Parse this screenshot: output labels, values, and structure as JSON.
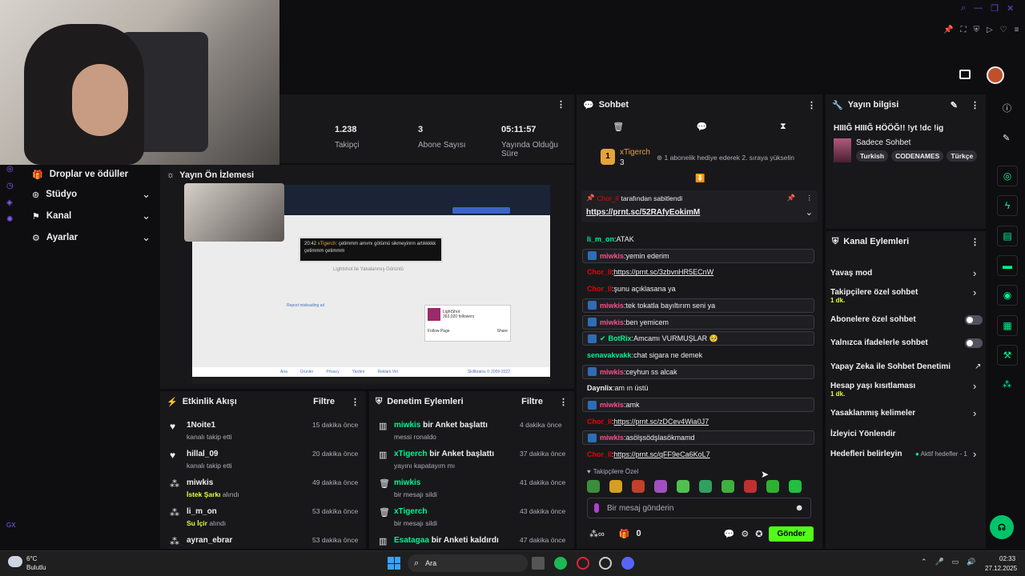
{
  "topbar": {
    "avatar_color": "#c0502a"
  },
  "stats": [
    {
      "value": "1.238",
      "label": "Takipçi"
    },
    {
      "value": "3",
      "label": "Abone Sayısı"
    },
    {
      "value": "05:11:57",
      "label": "Yayında Olduğu Süre"
    }
  ],
  "sidebar": {
    "items": [
      {
        "label": "Droplar ve ödüller",
        "icon": "gift-icon"
      },
      {
        "label": "Stüdyo",
        "icon": "studio-icon"
      },
      {
        "label": "Kanal",
        "icon": "channel-icon"
      },
      {
        "label": "Ayarlar",
        "icon": "gear-icon"
      }
    ],
    "gx": "GX"
  },
  "preview": {
    "title": "Yayın Ön İzlemesi",
    "overlay_time": "20:42",
    "overlay_user": "xTigerch",
    "overlay_msg": "çetimmm amımı götümü sikmeyinnn artıkkkkk çetimmm çetimmm",
    "site_title": "Lightshot ile Yakalanmış Görüntü",
    "ls_brand": "LightShot",
    "ls_followers": "363,020 followers",
    "ls_follow": "Follow Page",
    "ls_share": "Share",
    "footer_links": [
      "Ana",
      "Ürünler",
      "Privacy",
      "Yardım",
      "Reklam Ver"
    ],
    "footer_right": "Skillbrains © 2009-2022",
    "report": "Report misleading ad"
  },
  "activity": {
    "title": "Etkinlik Akışı",
    "filter": "Filtre",
    "items": [
      {
        "name": "1Noite1",
        "sub": "kanalı takip etti",
        "time": "15 dakika önce",
        "icon": "heart-icon"
      },
      {
        "name": "hillal_09",
        "sub": "kanalı takip etti",
        "time": "20 dakika önce",
        "icon": "heart-icon"
      },
      {
        "name": "miwkis",
        "sub_hl": "İstek Şarkı",
        "sub": "alındı",
        "time": "49 dakika önce",
        "icon": "points-icon"
      },
      {
        "name": "li_m_on",
        "sub_hl": "Su İçir",
        "sub": "alındı",
        "time": "53 dakika önce",
        "icon": "points-icon"
      },
      {
        "name": "ayran_ebrar",
        "sub": "",
        "time": "53 dakika önce",
        "icon": "points-icon"
      }
    ]
  },
  "mod_actions": {
    "title": "Denetim Eylemleri",
    "filter": "Filtre",
    "items": [
      {
        "name": "miwkis",
        "action": "bir Anket başlattı",
        "sub": "messi ronaldo",
        "time": "4 dakika önce",
        "icon": "poll-icon"
      },
      {
        "name": "xTigerch",
        "action": "bir Anket başlattı",
        "sub": "yayını kapatayım mı",
        "time": "37 dakika önce",
        "icon": "poll-icon"
      },
      {
        "name": "miwkis",
        "action": "",
        "sub": "bir mesajı sildi",
        "time": "41 dakika önce",
        "icon": "trash-icon"
      },
      {
        "name": "xTigerch",
        "action": "",
        "sub": "bir mesajı sildi",
        "time": "43 dakika önce",
        "icon": "trash-icon"
      },
      {
        "name": "Esatagaa",
        "action": "bir Anketi kaldırdı",
        "sub": "",
        "time": "47 dakika önce",
        "icon": "poll-icon"
      }
    ]
  },
  "chat": {
    "title": "Sohbet",
    "sub_user": "xTigerch",
    "sub_count": "3",
    "sub_msg": "1 abonelik hediye ederek 2. sıraya yükselin",
    "pin_by": "Chor_ll",
    "pin_suffix": "tarafından sabitlendi",
    "pin_link": "https://prnt.sc/52RAfyEokimM",
    "messages": [
      {
        "user": "li_m_on",
        "color": "#00f593",
        "text": "ATAK",
        "hl": false,
        "mod": false,
        "link": false
      },
      {
        "user": "miwkis",
        "color": "#ff4f8b",
        "text": "yemin ederim",
        "hl": true,
        "mod": true,
        "link": false
      },
      {
        "user": "Chor_ll",
        "color": "#eb0400",
        "text": "https://prnt.sc/3zbvnHR5ECnW",
        "hl": false,
        "mod": false,
        "link": true
      },
      {
        "user": "Chor_ll",
        "color": "#eb0400",
        "text": "şunu açıklasana ya",
        "hl": false,
        "mod": false,
        "link": false
      },
      {
        "user": "miwkis",
        "color": "#ff4f8b",
        "text": "tek tokatla bayıltırım seni ya",
        "hl": true,
        "mod": true,
        "link": false
      },
      {
        "user": "miwkis",
        "color": "#ff4f8b",
        "text": "ben yemicem",
        "hl": true,
        "mod": true,
        "link": false
      },
      {
        "user": "BotRix",
        "color": "#00f593",
        "text": "Amcamı VURMUŞLAR 🥺",
        "hl": true,
        "mod": true,
        "link": false
      },
      {
        "user": "senavakvakk",
        "color": "#00f593",
        "text": "chat sigara ne demek",
        "hl": false,
        "mod": false,
        "link": false
      },
      {
        "user": "miwkis",
        "color": "#ff4f8b",
        "text": "ceyhun ss alcak",
        "hl": true,
        "mod": true,
        "link": false
      },
      {
        "user": "Daynlix",
        "color": "#efeff1",
        "text": "am ın üstü",
        "hl": false,
        "mod": false,
        "link": false
      },
      {
        "user": "miwkis",
        "color": "#ff4f8b",
        "text": "amk",
        "hl": true,
        "mod": true,
        "link": false
      },
      {
        "user": "Chor_ll",
        "color": "#eb0400",
        "text": "https://prnt.sc/zDCev4Wia0J7",
        "hl": false,
        "mod": false,
        "link": true
      },
      {
        "user": "miwkis",
        "color": "#ff4f8b",
        "text": "asölşsödşlasökmamd",
        "hl": true,
        "mod": true,
        "link": false
      },
      {
        "user": "Chor_ll",
        "color": "#eb0400",
        "text": "https://prnt.sc/qFF9eCa6KoL7",
        "hl": false,
        "mod": false,
        "link": true
      }
    ],
    "followers_only": "Takipçilere Özel",
    "input_placeholder": "Bir mesaj gönderin",
    "points": "0",
    "send": "Gönder"
  },
  "stream_info": {
    "title": "Yayın bilgisi",
    "stream_title": "HIIIĞ HIIIĞ HÖÖĞ!! !yt !dc !ig",
    "category": "Sadece Sohbet",
    "tags": [
      "Turkish",
      "CODENAMES",
      "Türkçe"
    ]
  },
  "channel_actions": {
    "title": "Kanal Eylemleri",
    "items": [
      {
        "label": "Yavaş mod",
        "sub": "",
        "kind": "chevron"
      },
      {
        "label": "Takipçilere özel sohbet",
        "sub": "1 dk.",
        "kind": "chevron"
      },
      {
        "label": "Abonelere özel sohbet",
        "sub": "",
        "kind": "toggle"
      },
      {
        "label": "Yalnızca ifadelerle sohbet",
        "sub": "",
        "kind": "toggle"
      },
      {
        "label": "Yapay Zeka ile Sohbet Denetimi",
        "sub": "",
        "kind": "external"
      },
      {
        "label": "Hesap yaşı kısıtlaması",
        "sub": "1 dk.",
        "kind": "chevron"
      },
      {
        "label": "Yasaklanmış kelimeler",
        "sub": "",
        "kind": "chevron"
      },
      {
        "label": "İzleyici Yönlendir",
        "sub": "",
        "kind": "none"
      },
      {
        "label": "Hedefleri belirleyin",
        "sub": "",
        "kind": "goals",
        "extra": "Aktif hedefler - 1"
      }
    ]
  },
  "taskbar": {
    "weather_temp": "6°C",
    "weather_desc": "Bulutlu",
    "search": "Ara",
    "time": "02:33",
    "date": "27.12.2025"
  }
}
